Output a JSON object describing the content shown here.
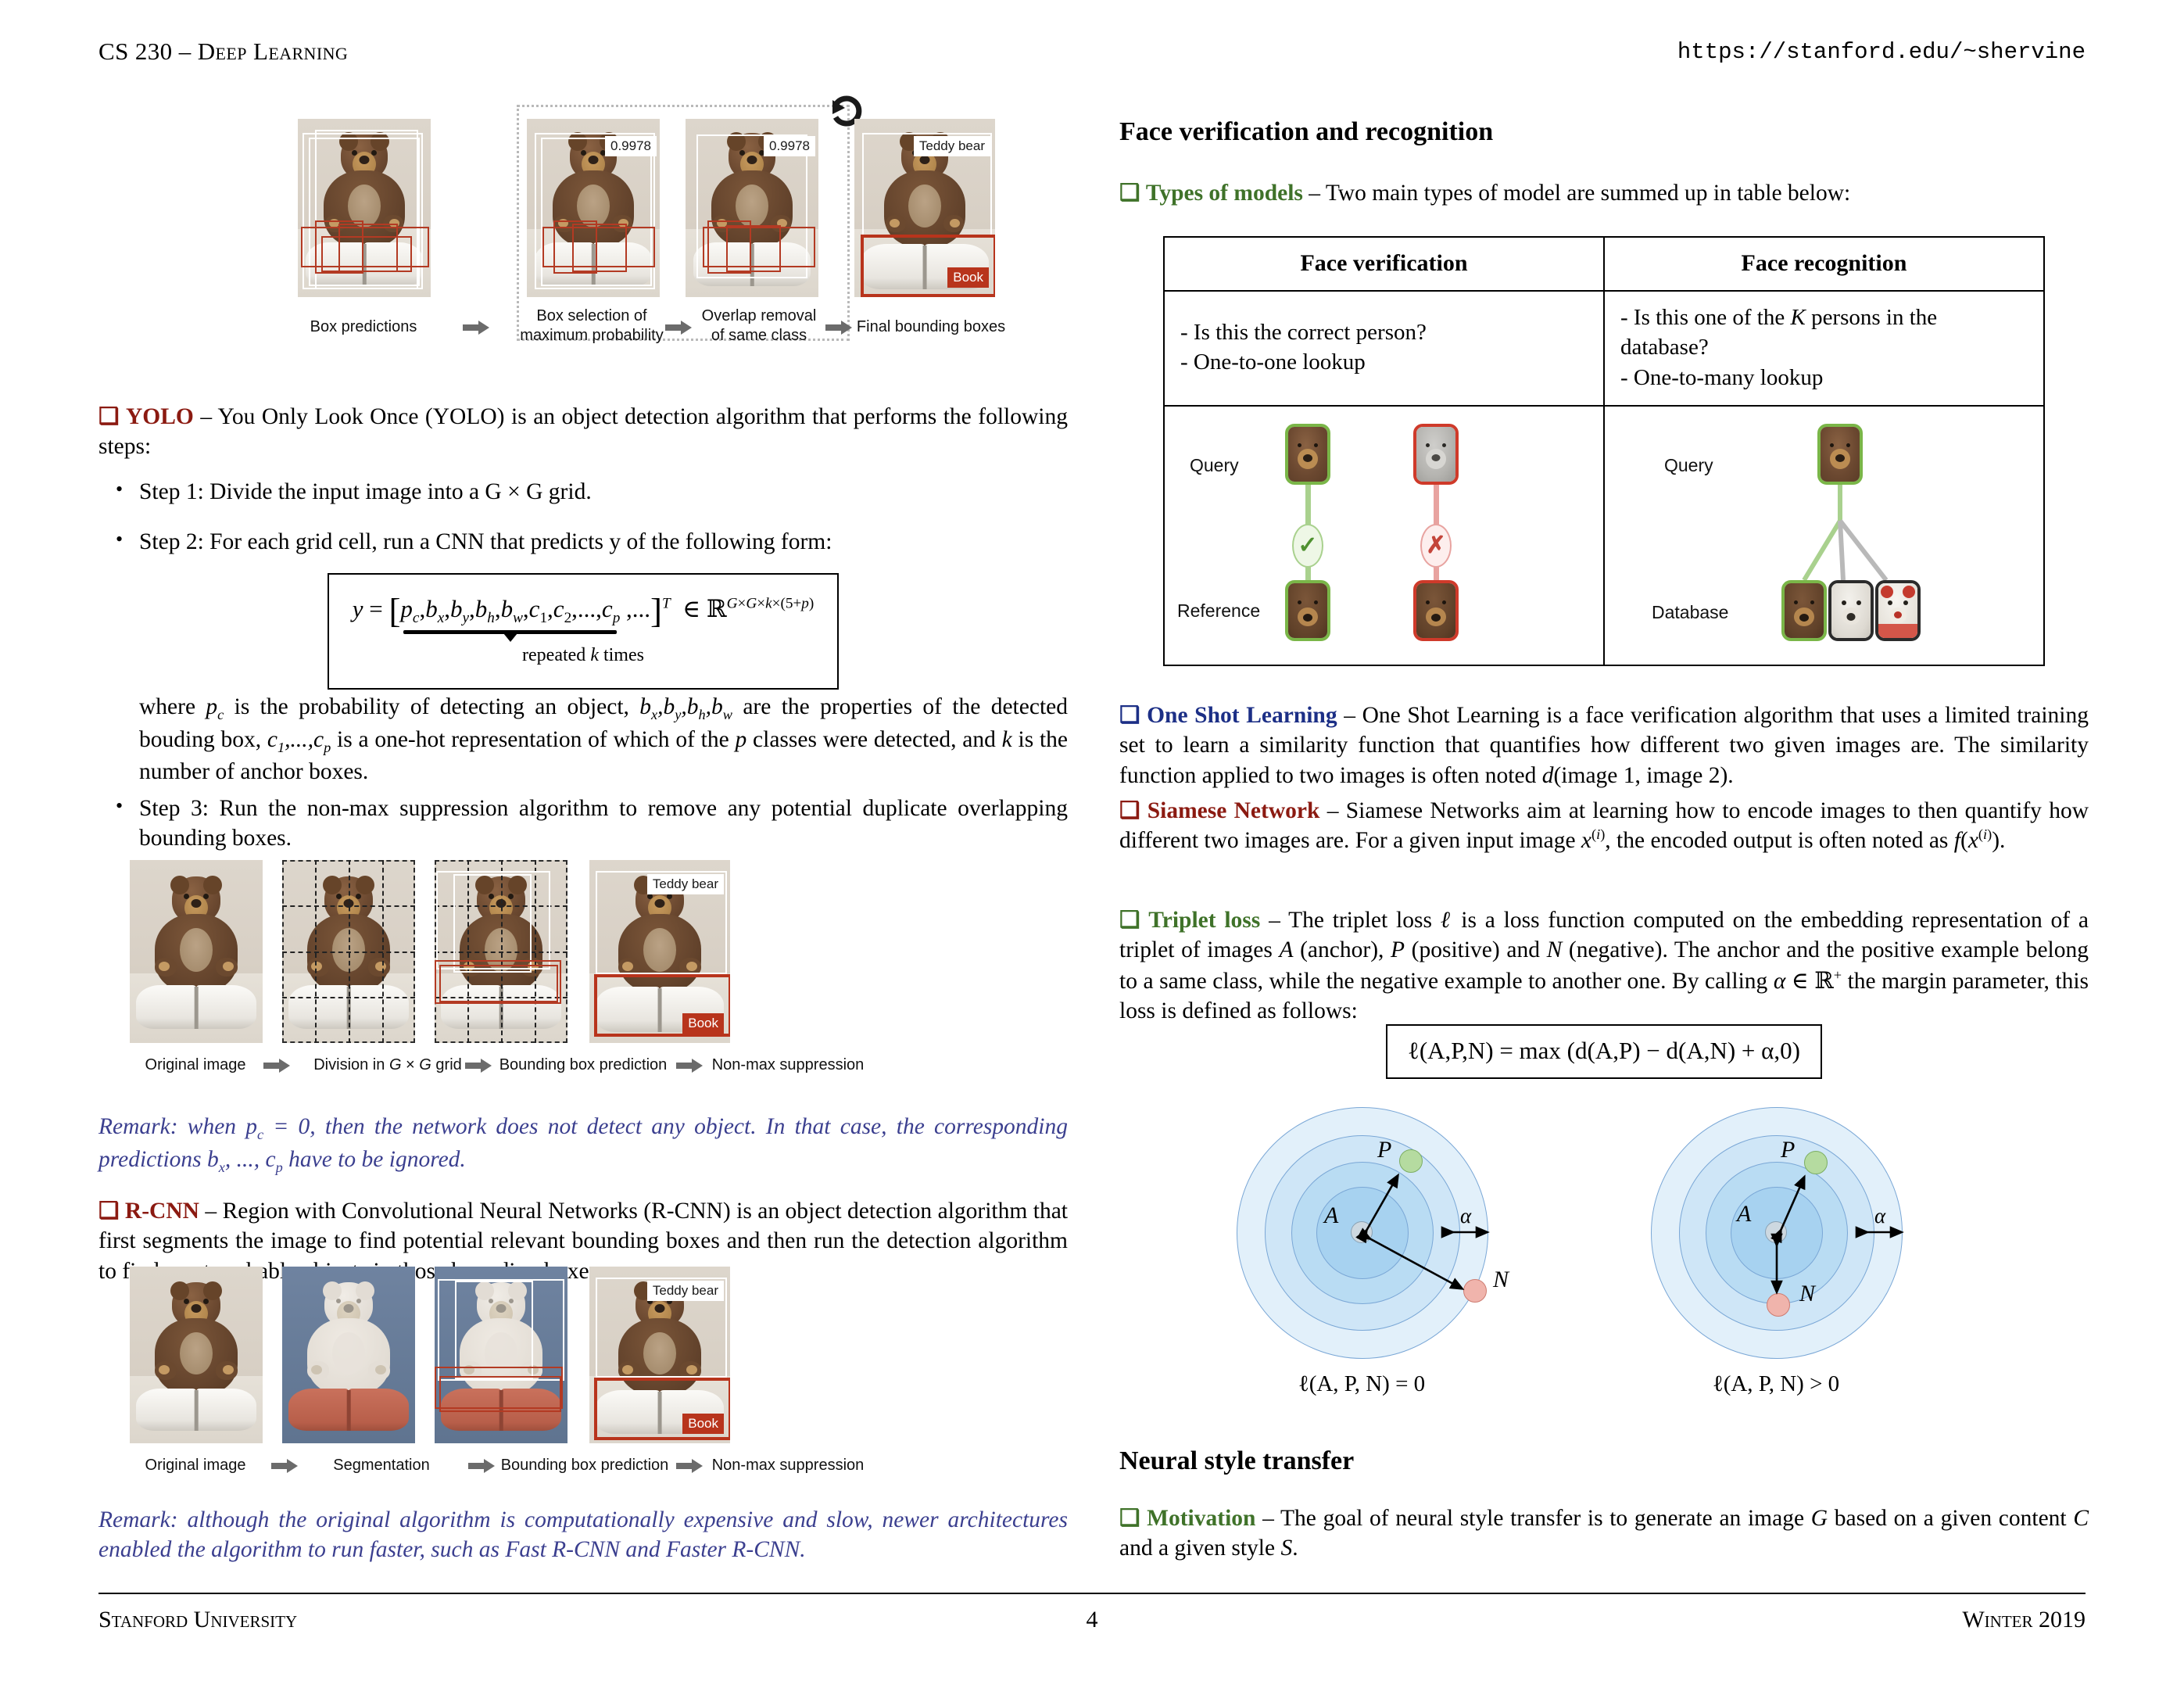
{
  "header": {
    "left": "CS 230 – Deep Learning",
    "right": "https://stanford.edu/~shervine"
  },
  "footer": {
    "left": "Stanford University",
    "page": "4",
    "right": "Winter 2019"
  },
  "left_column": {
    "nms_figure": {
      "captions": [
        "Box predictions",
        "Box selection of\nmaximum probability",
        "Overlap removal\nof same class",
        "Final bounding boxes"
      ],
      "caption_line1": [
        "Box predictions",
        "Box selection of",
        "Overlap removal",
        "Final bounding boxes"
      ],
      "caption_line2": [
        "",
        "maximum probability",
        "of same class",
        ""
      ],
      "score_labels": [
        "0.9978",
        "0.9978"
      ],
      "class_labels": [
        "Teddy bear",
        "Book"
      ]
    },
    "yolo": {
      "marker": "❑",
      "keyword": "YOLO",
      "intro": " – You Only Look Once (YOLO) is an object detection algorithm that performs the following steps:",
      "steps": [
        "Step 1: Divide the input image into a G × G grid.",
        "Step 2: For each grid cell, run a CNN that predicts y of the following form:",
        "Step 3: Run the non-max suppression algorithm to remove any potential duplicate overlapping bounding boxes."
      ],
      "formula": "y = [ p_c, b_x, b_y, b_h, b_w, c_1, c_2, ..., c_p , ... ]^T ∈ ℝ^{G×G×k×(5+p)}",
      "formula_parts": {
        "lhs": "y =",
        "vector": "p",
        "brace_note": "repeated k times",
        "transpose": "T",
        "member": "∈",
        "space": "ℝ",
        "exponent": "G×G×k×(5+p)"
      },
      "where_text": "where p_c is the probability of detecting an object, b_x,b_y,b_h,b_w are the properties of the detected bouding box, c_1,...,c_p is a one-hot representation of which of the p classes were detected, and k is the number of anchor boxes."
    },
    "yolo_figure": {
      "captions": [
        "Original image",
        "Division in G × G grid",
        "Bounding box prediction",
        "Non-max suppression"
      ],
      "class_labels": [
        "Teddy bear",
        "Book"
      ]
    },
    "remark_yolo": "Remark: when p_c = 0, then the network does not detect any object. In that case, the corresponding predictions b_x, ..., c_p have to be ignored.",
    "rcnn": {
      "marker": "❑",
      "keyword": "R-CNN",
      "text": " – Region with Convolutional Neural Networks (R-CNN) is an object detection algorithm that first segments the image to find potential relevant bounding boxes and then run the detection algorithm to find most probable objects in those bounding boxes."
    },
    "rcnn_figure": {
      "captions": [
        "Original image",
        "Segmentation",
        "Bounding box prediction",
        "Non-max suppression"
      ],
      "class_labels": [
        "Teddy bear",
        "Book"
      ]
    },
    "remark_rcnn": "Remark: although the original algorithm is computationally expensive and slow, newer architectures enabled the algorithm to run faster, such as Fast R-CNN and Faster R-CNN."
  },
  "right_column": {
    "section1_title": "Face verification and recognition",
    "types_of_models": {
      "marker": "❑",
      "keyword": "Types of models",
      "text": " – Two main types of model are summed up in table below:"
    },
    "table": {
      "headers": [
        "Face verification",
        "Face recognition"
      ],
      "rows": [
        [
          "- Is this the correct person?",
          "- Is this one of the K persons in the database?"
        ],
        [
          "- One-to-one lookup",
          "- One-to-many lookup"
        ]
      ],
      "figure_labels": {
        "verification": [
          "Query",
          "Reference"
        ],
        "recognition": [
          "Query",
          "Database"
        ],
        "check": "✓",
        "cross": "✗"
      }
    },
    "one_shot": {
      "marker": "❑",
      "keyword": "One Shot Learning",
      "text": " – One Shot Learning is a face verification algorithm that uses a limited training set to learn a similarity function that quantifies how different two given images are. The similarity function applied to two images is often noted d(image 1, image 2)."
    },
    "siamese": {
      "marker": "❑",
      "keyword": "Siamese Network",
      "text": " – Siamese Networks aim at learning how to encode images to then quantify how different two images are. For a given input image x(i), the encoded output is often noted as f(x(i))."
    },
    "triplet_loss": {
      "marker": "❑",
      "keyword": "Triplet loss",
      "text": " – The triplet loss ℓ is a loss function computed on the embedding representation of a triplet of images A (anchor), P (positive) and N (negative). The anchor and the positive example belong to a same class, while the negative example to another one. By calling α ∈ ℝ+ the margin parameter, this loss is defined as follows:",
      "formula": "ℓ(A,P,N) = max (d(A,P) − d(A,N) + α,0)"
    },
    "triplet_figure": {
      "labels": [
        "A",
        "P",
        "N",
        "α"
      ],
      "captions": [
        "ℓ(A, P, N) = 0",
        "ℓ(A, P, N) > 0"
      ]
    },
    "section2_title": "Neural style transfer",
    "motivation": {
      "marker": "❑",
      "keyword": "Motivation",
      "text": " – The goal of neural style transfer is to generate an image G based on a given content C and a given style S."
    }
  },
  "colors": {
    "red_keyword": "#8b1a11",
    "green_keyword": "#3f7229",
    "blue_keyword": "#1c2f86",
    "remark_blue": "#3b3f8f",
    "box_red": "#b33a23",
    "badge_green": "#7ab648"
  }
}
